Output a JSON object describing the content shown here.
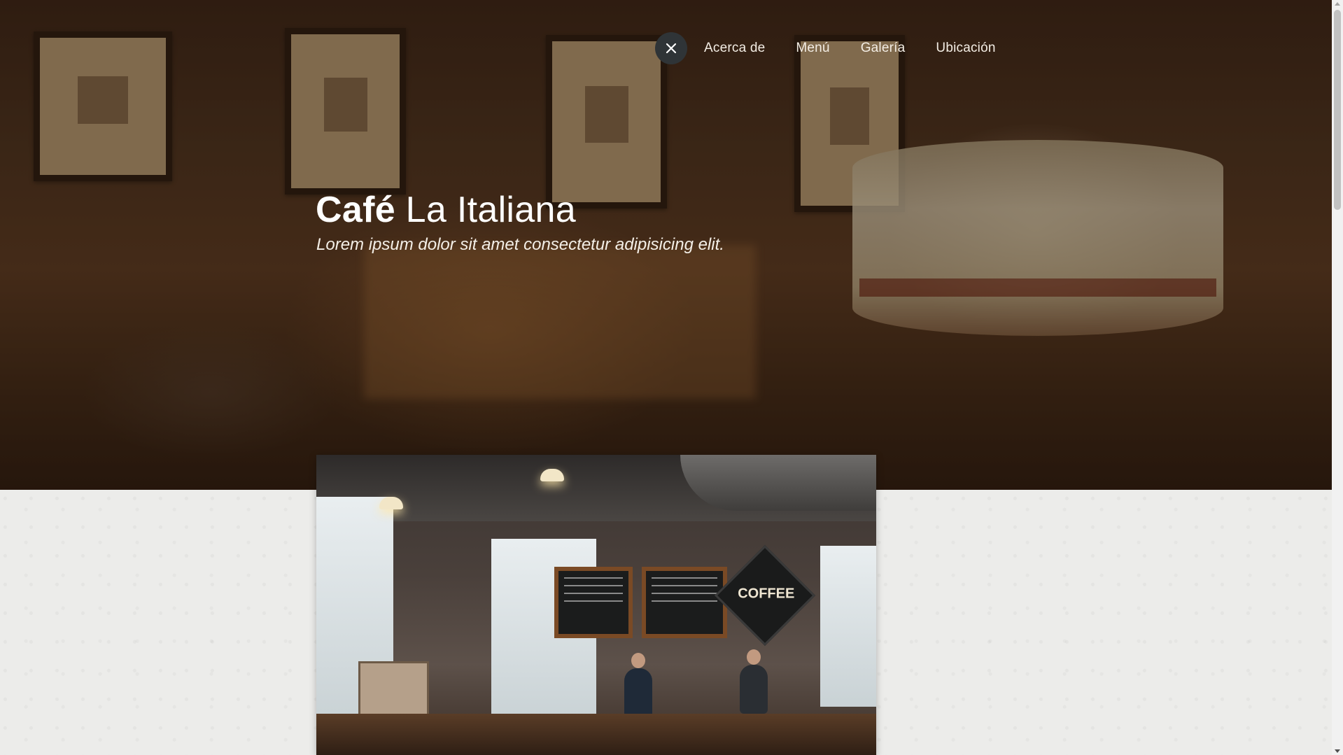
{
  "nav": {
    "close_icon": "close-icon",
    "items": [
      {
        "label": "Acerca de"
      },
      {
        "label": "Menú"
      },
      {
        "label": "Galería"
      },
      {
        "label": "Ubicación"
      }
    ]
  },
  "hero": {
    "title_bold": "Café",
    "title_rest": " La Italiana",
    "tagline": "Lorem ipsum dolor sit amet consectetur adipisicing elit."
  },
  "photo": {
    "coffee_sign": "COFFEE"
  },
  "colors": {
    "close_button": "#2f3437",
    "nav_text": "#f3ede4",
    "lower_background": "#ececea"
  }
}
